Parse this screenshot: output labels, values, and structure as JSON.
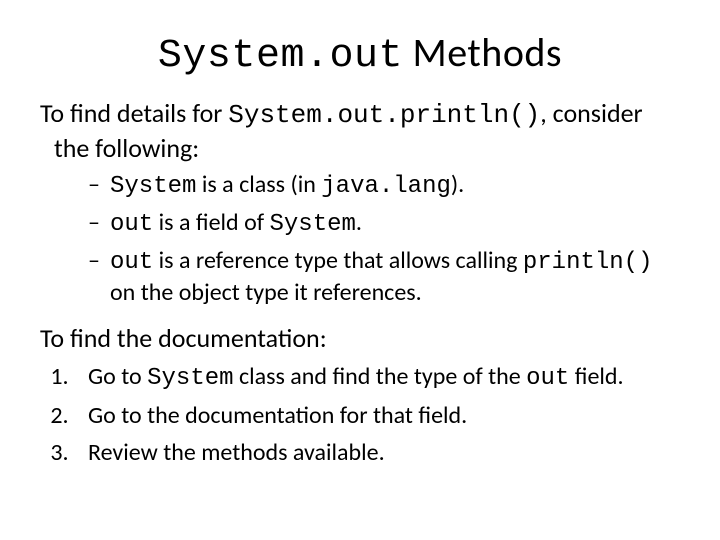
{
  "title": {
    "code": "System.out",
    "rest": " Methods"
  },
  "intro": {
    "pre": "To find details for ",
    "code": "System.out.println()",
    "post": ", consider the following:"
  },
  "bullets": [
    {
      "c1": "System",
      "t1": " is a class (in ",
      "c2": "java.lang",
      "t2": ")."
    },
    {
      "c1": "out",
      "t1": " is a field of ",
      "c2": "System",
      "t2": "."
    },
    {
      "c1": "out",
      "t1": " is a reference type that allows calling ",
      "c2": "println()",
      "t2": " on the object type it references."
    }
  ],
  "doc_heading": "To find the documentation:",
  "steps": [
    {
      "t0": "Go to ",
      "c1": "System",
      "t1": " class and find the type of the ",
      "c2": "out",
      "t2": " field."
    },
    {
      "t0": "Go to the documentation for that field."
    },
    {
      "t0": "Review the methods available."
    }
  ]
}
